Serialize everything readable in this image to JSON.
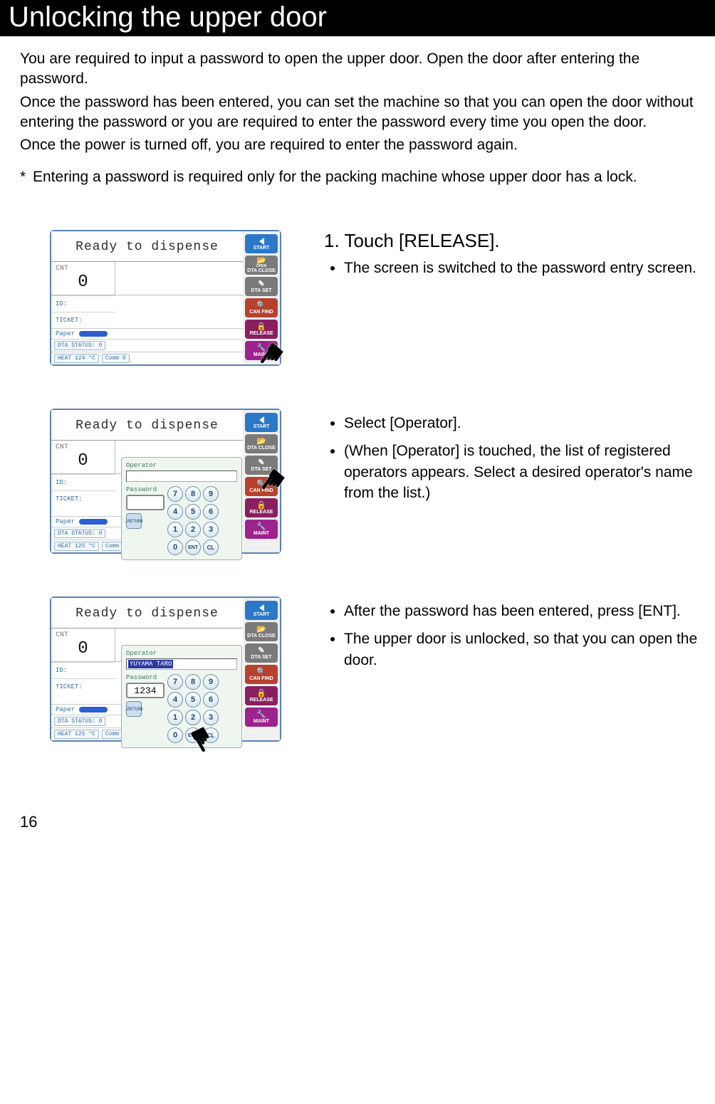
{
  "title": "Unlocking the upper door",
  "intro": {
    "p1": "You are required to input a password to open the upper door.  Open the door after entering the password.",
    "p2": "Once the password has been entered, you can set the machine so that you can open the door without entering the password or you are required to enter the password every time you open the door.",
    "p3": "Once the power is turned off, you are required to enter the password again."
  },
  "note": {
    "asterisk": "*",
    "text": "Entering a password is required only for the packing machine whose upper door has a lock."
  },
  "step1": {
    "heading": "1. Touch [RELEASE].",
    "bullet1": "The screen is switched to the password entry screen."
  },
  "step2": {
    "bullet1": "Select [Operator].",
    "bullet2": "(When [Operator] is touched, the list of registered operators appears.  Select a desired operator's name from the list.)"
  },
  "step3": {
    "bullet1": "After the password has been entered, press [ENT].",
    "bullet2": "The upper door is unlocked, so that you can open the door."
  },
  "screen": {
    "header": "Ready to dispense",
    "cnt_label": "CNT",
    "cnt_value": "0",
    "id_label": "ID:",
    "ticket_label": "TICKET:",
    "paper_label": "Paper",
    "dta_status": "DTA STATUS:    0",
    "heat1": "HEAT 124 °C",
    "heat2": "HEAT 125 °C",
    "comm": "Comm 0",
    "operator_label": "Operator",
    "password_label": "Password",
    "operator_value": "YUYAMA TARO",
    "password_value": "1234",
    "side": {
      "start": "START",
      "dta_oc": "DTA CLOSE",
      "dta_oc_top": "OPEN",
      "dta_set": "DTA SET",
      "can_find": "CAN FIND",
      "release": "RELEASE",
      "maint": "MAINT"
    },
    "keys": {
      "return": "RETURN",
      "ent": "ENT",
      "cl": "CL"
    }
  },
  "page_number": "16"
}
